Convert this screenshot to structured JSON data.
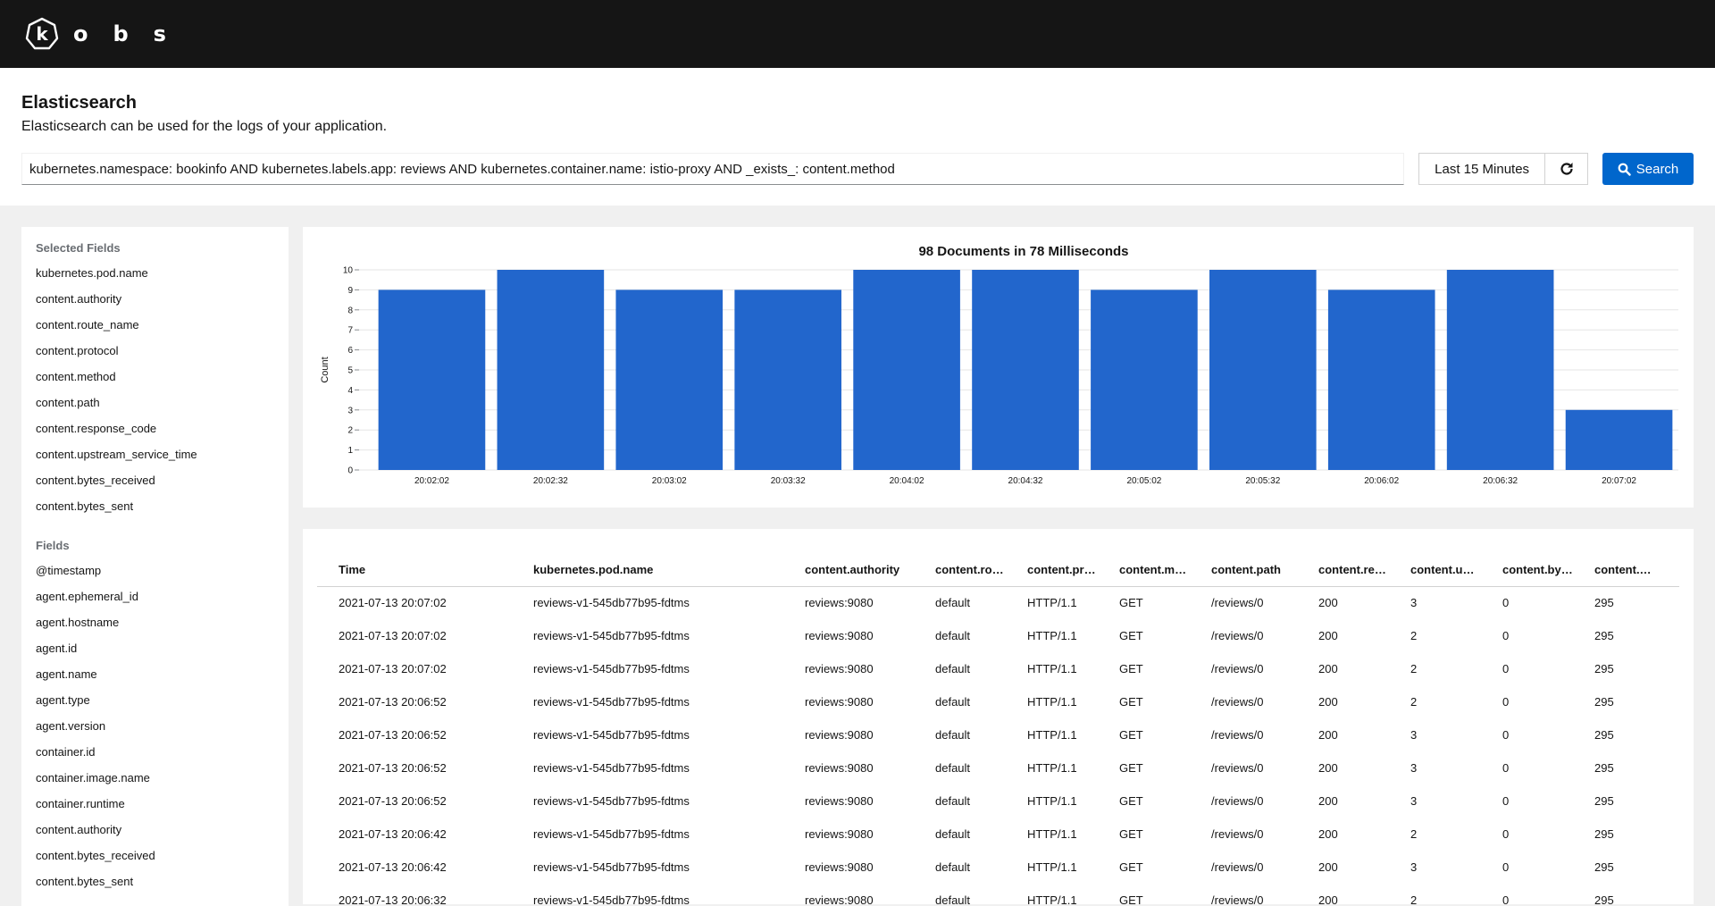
{
  "app": {
    "name": "obs",
    "logo_letter": "k"
  },
  "header": {
    "title": "Elasticsearch",
    "description": "Elasticsearch can be used for the logs of your application."
  },
  "toolbar": {
    "query": "kubernetes.namespace: bookinfo AND kubernetes.labels.app: reviews AND kubernetes.container.name: istio-proxy AND _exists_: content.method",
    "time_range": "Last 15 Minutes",
    "search_label": "Search"
  },
  "sidebar": {
    "selected_heading": "Selected Fields",
    "selected_fields": [
      "kubernetes.pod.name",
      "content.authority",
      "content.route_name",
      "content.protocol",
      "content.method",
      "content.path",
      "content.response_code",
      "content.upstream_service_time",
      "content.bytes_received",
      "content.bytes_sent"
    ],
    "fields_heading": "Fields",
    "fields": [
      "@timestamp",
      "agent.ephemeral_id",
      "agent.hostname",
      "agent.id",
      "agent.name",
      "agent.type",
      "agent.version",
      "container.id",
      "container.image.name",
      "container.runtime",
      "content.authority",
      "content.bytes_received",
      "content.bytes_sent"
    ]
  },
  "chart_data": {
    "type": "bar",
    "title": "98 Documents in 78 Milliseconds",
    "ylabel": "Count",
    "xlabel": "",
    "categories": [
      "20:02:02",
      "20:02:32",
      "20:03:02",
      "20:03:32",
      "20:04:02",
      "20:04:32",
      "20:05:02",
      "20:05:32",
      "20:06:02",
      "20:06:32",
      "20:07:02"
    ],
    "values": [
      9,
      10,
      9,
      9,
      10,
      10,
      9,
      10,
      9,
      10,
      3
    ],
    "yticks": [
      "0",
      "1",
      "2",
      "3",
      "4",
      "5",
      "6",
      "7",
      "8",
      "9",
      "10"
    ],
    "ylim": [
      0,
      10
    ],
    "bar_color": "#2266cc"
  },
  "table": {
    "columns": [
      "Time",
      "kubernetes.pod.name",
      "content.authority",
      "content.rou…",
      "content.pro…",
      "content.me…",
      "content.path",
      "content.res…",
      "content.up…",
      "content.byt…",
      "content.…"
    ],
    "rows": [
      [
        "2021-07-13 20:07:02",
        "reviews-v1-545db77b95-fdtms",
        "reviews:9080",
        "default",
        "HTTP/1.1",
        "GET",
        "/reviews/0",
        "200",
        "3",
        "0",
        "295"
      ],
      [
        "2021-07-13 20:07:02",
        "reviews-v1-545db77b95-fdtms",
        "reviews:9080",
        "default",
        "HTTP/1.1",
        "GET",
        "/reviews/0",
        "200",
        "2",
        "0",
        "295"
      ],
      [
        "2021-07-13 20:07:02",
        "reviews-v1-545db77b95-fdtms",
        "reviews:9080",
        "default",
        "HTTP/1.1",
        "GET",
        "/reviews/0",
        "200",
        "2",
        "0",
        "295"
      ],
      [
        "2021-07-13 20:06:52",
        "reviews-v1-545db77b95-fdtms",
        "reviews:9080",
        "default",
        "HTTP/1.1",
        "GET",
        "/reviews/0",
        "200",
        "2",
        "0",
        "295"
      ],
      [
        "2021-07-13 20:06:52",
        "reviews-v1-545db77b95-fdtms",
        "reviews:9080",
        "default",
        "HTTP/1.1",
        "GET",
        "/reviews/0",
        "200",
        "3",
        "0",
        "295"
      ],
      [
        "2021-07-13 20:06:52",
        "reviews-v1-545db77b95-fdtms",
        "reviews:9080",
        "default",
        "HTTP/1.1",
        "GET",
        "/reviews/0",
        "200",
        "3",
        "0",
        "295"
      ],
      [
        "2021-07-13 20:06:52",
        "reviews-v1-545db77b95-fdtms",
        "reviews:9080",
        "default",
        "HTTP/1.1",
        "GET",
        "/reviews/0",
        "200",
        "3",
        "0",
        "295"
      ],
      [
        "2021-07-13 20:06:42",
        "reviews-v1-545db77b95-fdtms",
        "reviews:9080",
        "default",
        "HTTP/1.1",
        "GET",
        "/reviews/0",
        "200",
        "2",
        "0",
        "295"
      ],
      [
        "2021-07-13 20:06:42",
        "reviews-v1-545db77b95-fdtms",
        "reviews:9080",
        "default",
        "HTTP/1.1",
        "GET",
        "/reviews/0",
        "200",
        "3",
        "0",
        "295"
      ],
      [
        "2021-07-13 20:06:32",
        "reviews-v1-545db77b95-fdtms",
        "reviews:9080",
        "default",
        "HTTP/1.1",
        "GET",
        "/reviews/0",
        "200",
        "2",
        "0",
        "295"
      ]
    ]
  }
}
